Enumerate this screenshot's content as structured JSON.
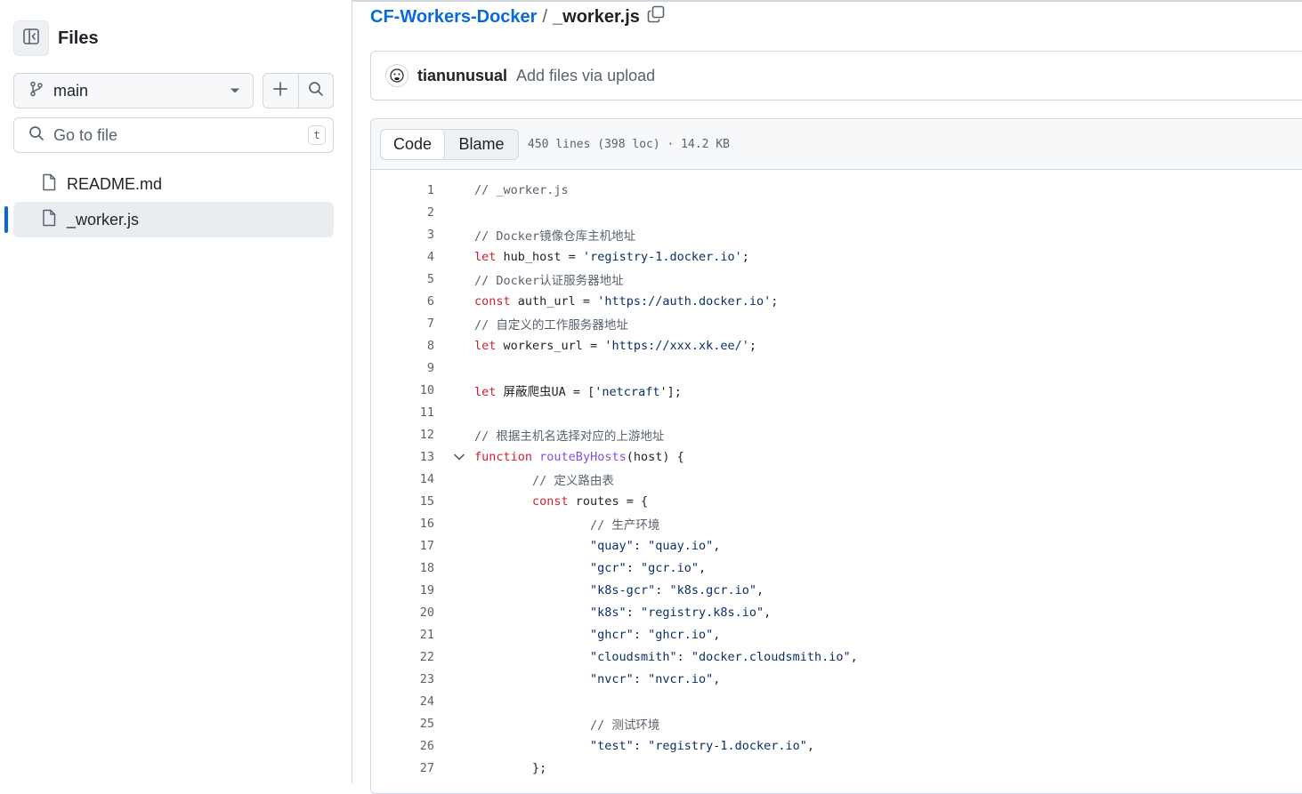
{
  "sidebar": {
    "title": "Files",
    "branch": "main",
    "goto_placeholder": "Go to file",
    "goto_shortcut": "t",
    "files": [
      {
        "name": "README.md",
        "active": false
      },
      {
        "name": "_worker.js",
        "active": true
      }
    ]
  },
  "breadcrumb": {
    "repo": "CF-Workers-Docker",
    "separator": "/",
    "file": "_worker.js"
  },
  "commit": {
    "author": "tianunusual",
    "message": "Add files via upload"
  },
  "viewer": {
    "code_tab": "Code",
    "blame_tab": "Blame",
    "meta": "450 lines (398 loc) · 14.2 KB"
  },
  "code": {
    "lines": [
      {
        "n": "1",
        "tokens": [
          {
            "t": "// _worker.js",
            "c": "cm"
          }
        ]
      },
      {
        "n": "2",
        "tokens": []
      },
      {
        "n": "3",
        "tokens": [
          {
            "t": "// Docker镜像仓库主机地址",
            "c": "cm"
          }
        ]
      },
      {
        "n": "4",
        "tokens": [
          {
            "t": "let",
            "c": "kw"
          },
          {
            "t": " hub_host = ",
            "c": ""
          },
          {
            "t": "'registry-1.docker.io'",
            "c": "str"
          },
          {
            "t": ";",
            "c": ""
          }
        ]
      },
      {
        "n": "5",
        "tokens": [
          {
            "t": "// Docker认证服务器地址",
            "c": "cm"
          }
        ]
      },
      {
        "n": "6",
        "tokens": [
          {
            "t": "const",
            "c": "kw"
          },
          {
            "t": " auth_url = ",
            "c": ""
          },
          {
            "t": "'https://auth.docker.io'",
            "c": "str"
          },
          {
            "t": ";",
            "c": ""
          }
        ]
      },
      {
        "n": "7",
        "tokens": [
          {
            "t": "// 自定义的工作服务器地址",
            "c": "cm"
          }
        ]
      },
      {
        "n": "8",
        "tokens": [
          {
            "t": "let",
            "c": "kw"
          },
          {
            "t": " workers_url = ",
            "c": ""
          },
          {
            "t": "'https://xxx.xk.ee/'",
            "c": "str"
          },
          {
            "t": ";",
            "c": ""
          }
        ]
      },
      {
        "n": "9",
        "tokens": []
      },
      {
        "n": "10",
        "tokens": [
          {
            "t": "let",
            "c": "kw"
          },
          {
            "t": " 屏蔽爬虫UA = [",
            "c": ""
          },
          {
            "t": "'netcraft'",
            "c": "str"
          },
          {
            "t": "];",
            "c": ""
          }
        ]
      },
      {
        "n": "11",
        "tokens": []
      },
      {
        "n": "12",
        "tokens": [
          {
            "t": "// 根据主机名选择对应的上游地址",
            "c": "cm"
          }
        ]
      },
      {
        "n": "13",
        "fold": true,
        "tokens": [
          {
            "t": "function",
            "c": "kw"
          },
          {
            "t": " ",
            "c": ""
          },
          {
            "t": "routeByHosts",
            "c": "fn"
          },
          {
            "t": "(host) {",
            "c": ""
          }
        ]
      },
      {
        "n": "14",
        "tokens": [
          {
            "t": "        ",
            "c": ""
          },
          {
            "t": "// 定义路由表",
            "c": "cm"
          }
        ]
      },
      {
        "n": "15",
        "tokens": [
          {
            "t": "        ",
            "c": ""
          },
          {
            "t": "const",
            "c": "kw"
          },
          {
            "t": " routes = {",
            "c": ""
          }
        ]
      },
      {
        "n": "16",
        "tokens": [
          {
            "t": "                ",
            "c": ""
          },
          {
            "t": "// 生产环境",
            "c": "cm"
          }
        ]
      },
      {
        "n": "17",
        "tokens": [
          {
            "t": "                ",
            "c": ""
          },
          {
            "t": "\"quay\"",
            "c": "str"
          },
          {
            "t": ": ",
            "c": ""
          },
          {
            "t": "\"quay.io\"",
            "c": "str"
          },
          {
            "t": ",",
            "c": ""
          }
        ]
      },
      {
        "n": "18",
        "tokens": [
          {
            "t": "                ",
            "c": ""
          },
          {
            "t": "\"gcr\"",
            "c": "str"
          },
          {
            "t": ": ",
            "c": ""
          },
          {
            "t": "\"gcr.io\"",
            "c": "str"
          },
          {
            "t": ",",
            "c": ""
          }
        ]
      },
      {
        "n": "19",
        "tokens": [
          {
            "t": "                ",
            "c": ""
          },
          {
            "t": "\"k8s-gcr\"",
            "c": "str"
          },
          {
            "t": ": ",
            "c": ""
          },
          {
            "t": "\"k8s.gcr.io\"",
            "c": "str"
          },
          {
            "t": ",",
            "c": ""
          }
        ]
      },
      {
        "n": "20",
        "tokens": [
          {
            "t": "                ",
            "c": ""
          },
          {
            "t": "\"k8s\"",
            "c": "str"
          },
          {
            "t": ": ",
            "c": ""
          },
          {
            "t": "\"registry.k8s.io\"",
            "c": "str"
          },
          {
            "t": ",",
            "c": ""
          }
        ]
      },
      {
        "n": "21",
        "tokens": [
          {
            "t": "                ",
            "c": ""
          },
          {
            "t": "\"ghcr\"",
            "c": "str"
          },
          {
            "t": ": ",
            "c": ""
          },
          {
            "t": "\"ghcr.io\"",
            "c": "str"
          },
          {
            "t": ",",
            "c": ""
          }
        ]
      },
      {
        "n": "22",
        "tokens": [
          {
            "t": "                ",
            "c": ""
          },
          {
            "t": "\"cloudsmith\"",
            "c": "str"
          },
          {
            "t": ": ",
            "c": ""
          },
          {
            "t": "\"docker.cloudsmith.io\"",
            "c": "str"
          },
          {
            "t": ",",
            "c": ""
          }
        ]
      },
      {
        "n": "23",
        "tokens": [
          {
            "t": "                ",
            "c": ""
          },
          {
            "t": "\"nvcr\"",
            "c": "str"
          },
          {
            "t": ": ",
            "c": ""
          },
          {
            "t": "\"nvcr.io\"",
            "c": "str"
          },
          {
            "t": ",",
            "c": ""
          }
        ]
      },
      {
        "n": "24",
        "tokens": []
      },
      {
        "n": "25",
        "tokens": [
          {
            "t": "                ",
            "c": ""
          },
          {
            "t": "// 测试环境",
            "c": "cm"
          }
        ]
      },
      {
        "n": "26",
        "tokens": [
          {
            "t": "                ",
            "c": ""
          },
          {
            "t": "\"test\"",
            "c": "str"
          },
          {
            "t": ": ",
            "c": ""
          },
          {
            "t": "\"registry-1.docker.io\"",
            "c": "str"
          },
          {
            "t": ",",
            "c": ""
          }
        ]
      },
      {
        "n": "27",
        "tokens": [
          {
            "t": "        };",
            "c": ""
          }
        ]
      }
    ]
  },
  "colors": {
    "link": "#0969da",
    "keyword": "#cf222e",
    "string": "#0a3069",
    "function": "#8250df",
    "comment": "#59636e",
    "active_indicator": "#0969da"
  }
}
